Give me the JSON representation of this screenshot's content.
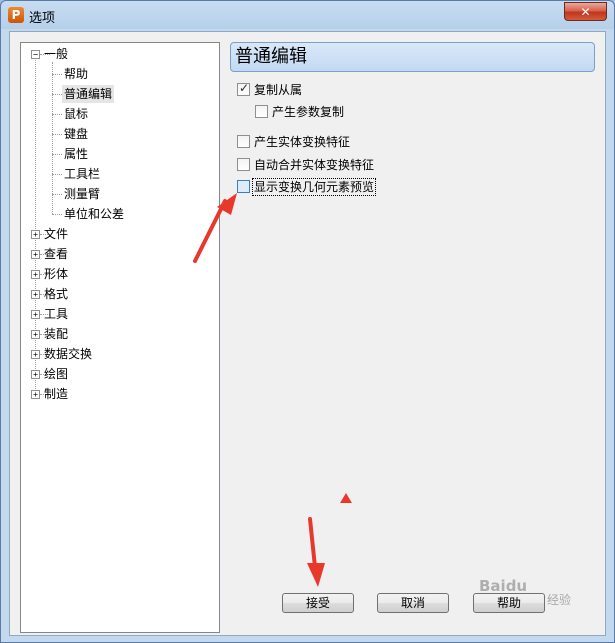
{
  "window": {
    "title": "选项",
    "app_icon_letter": "P",
    "close_label": "✕"
  },
  "tree": {
    "general": {
      "label": "一般",
      "expander": "−"
    },
    "general_children": [
      "帮助",
      "普通编辑",
      "鼠标",
      "键盘",
      "属性",
      "工具栏",
      "测量臂",
      "单位和公差"
    ],
    "selected": "普通编辑",
    "roots": [
      "文件",
      "查看",
      "形体",
      "格式",
      "工具",
      "装配",
      "数据交换",
      "绘图",
      "制造"
    ],
    "root_expander": "+"
  },
  "panel": {
    "title": "普通编辑"
  },
  "options": {
    "copy_from_attr": {
      "label": "复制从属",
      "checked": true
    },
    "generate_param_copy": {
      "label": "产生参数复制",
      "checked": false
    },
    "generate_entity_transform": {
      "label": "产生实体变换特征",
      "checked": false
    },
    "auto_merge_transform": {
      "label": "自动合并实体变换特征",
      "checked": false
    },
    "show_transform_preview": {
      "label": "显示变换几何元素预览",
      "checked": false
    }
  },
  "buttons": {
    "accept": "接受",
    "cancel": "取消",
    "help": "帮助"
  },
  "watermark": {
    "text": "Baidu",
    "sub": "经验"
  },
  "colors": {
    "annotation_arrow": "#e8382c"
  }
}
